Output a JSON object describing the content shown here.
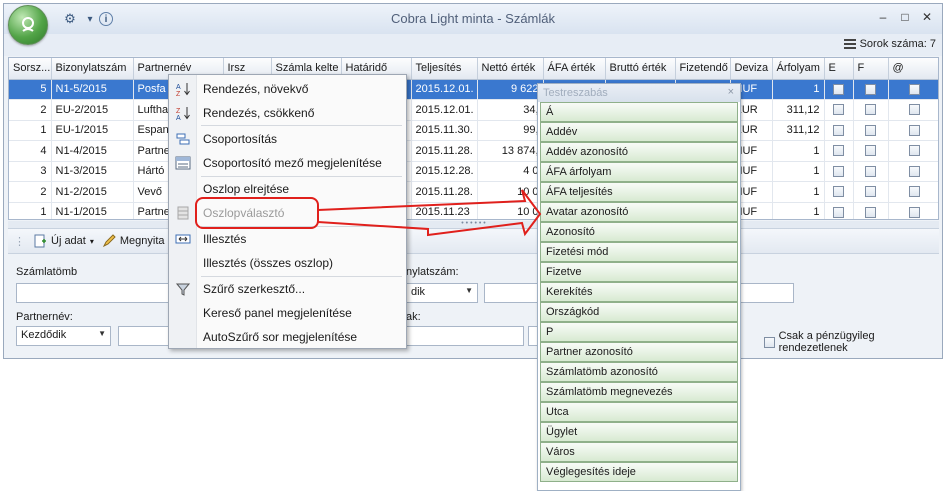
{
  "window": {
    "title": "Cobra Light minta - Számlák",
    "controls": [
      "–",
      "□",
      "✕"
    ]
  },
  "quick_access": {
    "gear": "⚙",
    "dropdown": "▾",
    "info": "i"
  },
  "toolbar": {
    "row_count": "Sorok száma: 7"
  },
  "grid": {
    "columns": [
      "Sorsz...",
      "Bizonylatszám",
      "Partnernév",
      "Irsz",
      "Számla kelte",
      "Határidő",
      "Teljesítés",
      "Nettó érték",
      "ÁFA érték",
      "Bruttó érték",
      "Fizetendő",
      "Deviza",
      "Árfolyam",
      "E",
      "F",
      "@"
    ],
    "rows": [
      {
        "sorsz": "5",
        "bizonylat": "N1-5/2015",
        "partner": "Posfa",
        "teljesites": "2015.12.01.",
        "netto": "9 622",
        "deviza": "HUF",
        "arfolyam": "1",
        "selected": true
      },
      {
        "sorsz": "2",
        "bizonylat": "EU-2/2015",
        "partner": "Lufthа",
        "teljesites": "2015.12.01.",
        "netto": "34,",
        "deviza": "EUR",
        "arfolyam": "311,12",
        "selected": false
      },
      {
        "sorsz": "1",
        "bizonylat": "EU-1/2015",
        "partner": "Espan",
        "teljesites": "2015.11.30.",
        "netto": "99,",
        "deviza": "EUR",
        "arfolyam": "311,12",
        "selected": false
      },
      {
        "sorsz": "4",
        "bizonylat": "N1-4/2015",
        "partner": "Partne",
        "teljesites": "2015.11.28.",
        "netto": "13 874,",
        "deviza": "HUF",
        "arfolyam": "1",
        "selected": false
      },
      {
        "sorsz": "3",
        "bizonylat": "N1-3/2015",
        "partner": "Hártó",
        "teljesites": "2015.12.28.",
        "netto": "4 0",
        "deviza": "HUF",
        "arfolyam": "1",
        "selected": false
      },
      {
        "sorsz": "2",
        "bizonylat": "N1-2/2015",
        "partner": "Vevő",
        "teljesites": "2015.11.28.",
        "netto": "10 0",
        "deviza": "HUF",
        "arfolyam": "1",
        "selected": false
      },
      {
        "sorsz": "1",
        "bizonylat": "N1-1/2015",
        "partner": "Partne",
        "teljesites": "2015.11.23",
        "netto": "10 0",
        "deviza": "HUF",
        "arfolyam": "1",
        "selected": false
      }
    ]
  },
  "actions": {
    "new": "Új adat",
    "open": "Megnyita"
  },
  "filters": {
    "szamlatomb_label": "Számlatömb",
    "bizonylatszam_label": "nylatszám:",
    "bizonylatszam_mode": "dik",
    "partnernev_label": "Partnernév:",
    "partnernev_mode": "Kezdődik",
    "third_label": "ak:",
    "checkbox_label": "Csak a pénzügyileg rendezetlenek"
  },
  "context_menu": {
    "items": [
      {
        "label": "Rendezés, növekvő",
        "icon": "sort-ascending-icon",
        "disabled": false
      },
      {
        "label": "Rendezés, csökkenő",
        "icon": "sort-descending-icon",
        "disabled": false
      },
      {
        "label": "Csoportosítás",
        "icon": "group-icon",
        "disabled": false
      },
      {
        "label": "Csoportosító mező megjelenítése",
        "icon": "group-panel-icon",
        "disabled": false
      },
      {
        "label": "Oszlop elrejtése",
        "icon": "",
        "disabled": false
      },
      {
        "label": "Oszlopválasztó",
        "icon": "column-chooser-icon",
        "disabled": true
      },
      {
        "label": "Illesztés",
        "icon": "best-fit-icon",
        "disabled": false
      },
      {
        "label": "Illesztés (összes oszlop)",
        "icon": "",
        "disabled": false
      },
      {
        "label": "Szűrő szerkesztő...",
        "icon": "filter-icon",
        "disabled": false
      },
      {
        "label": "Kereső panel megjelenítése",
        "icon": "",
        "disabled": false
      },
      {
        "label": "AutoSzűrő sor megjelenítése",
        "icon": "",
        "disabled": false
      }
    ]
  },
  "customization": {
    "title": "Testreszabás",
    "close": "×",
    "items": [
      "Á",
      "Addév",
      "Addév azonosító",
      "ÁFA árfolyam",
      "ÁFA teljesítés",
      "Avatar azonosító",
      "Azonosító",
      "Fizetési mód",
      "Fizetve",
      "Kerekítés",
      "Országkód",
      "P",
      "Partner azonosító",
      "Számlatömb azonosító",
      "Számlatömb megnevezés",
      "Utca",
      "Ügylet",
      "Város",
      "Véglegesítés ideje"
    ]
  },
  "colors": {
    "accent": "#3a78cf",
    "annotation": "#e0201c",
    "item_border": "#8fb08a"
  }
}
